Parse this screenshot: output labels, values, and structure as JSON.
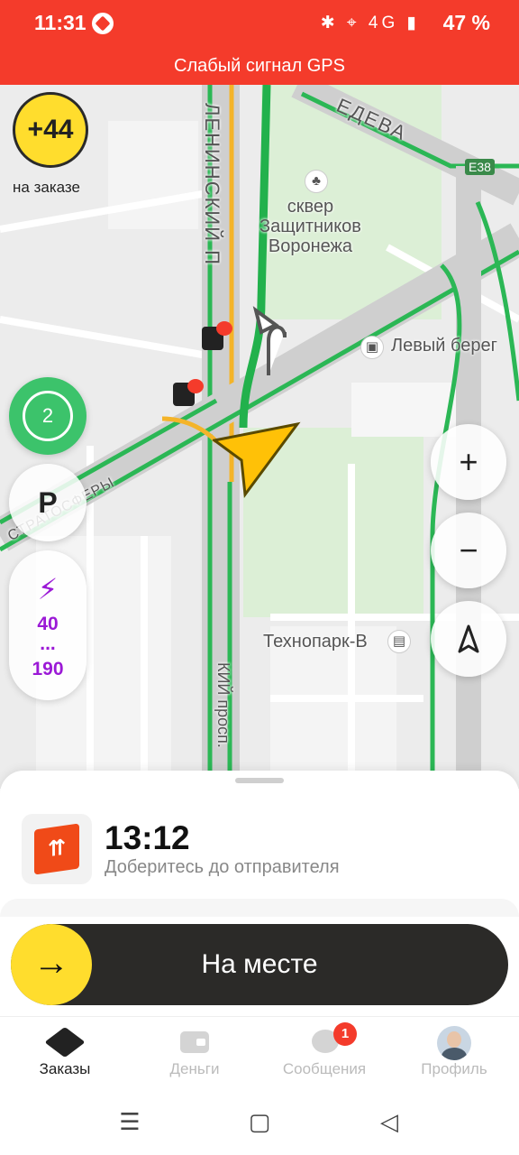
{
  "status_bar": {
    "time": "11:31",
    "icons": "✱ ⌖ 4G ▮",
    "battery": "47 %"
  },
  "gps_banner": "Слабый сигнал GPS",
  "map": {
    "street_leninsky": "ЛЕНИНСКИЙ П",
    "street_leninsky_bottom": "КИЙ просп.",
    "street_top": "ЕДЕВА",
    "street_sfery": "СТРАТОСФЕРЫ",
    "road_code": "E38",
    "park_name": "сквер\nЗащитников\nВоронежа",
    "poi_left_bank": "Левый берег",
    "poi_technopark": "Технопарк-В"
  },
  "widgets": {
    "earnings": "+44",
    "earnings_label": "на заказе",
    "gps_count": "2",
    "parking": "P",
    "speed_min": "40",
    "speed_dots": "...",
    "speed_max": "190"
  },
  "map_controls": {
    "zoom_in": "+",
    "zoom_out": "−"
  },
  "order": {
    "eta": "13:12",
    "instruction": "Доберитесь до отправителя",
    "slider_label": "На месте"
  },
  "tabs": [
    {
      "label": "Заказы",
      "active": true
    },
    {
      "label": "Деньги",
      "active": false
    },
    {
      "label": "Сообщения",
      "active": false,
      "badge": "1"
    },
    {
      "label": "Профиль",
      "active": false
    }
  ],
  "colors": {
    "accent_red": "#f43b2b",
    "accent_yellow": "#ffdd2d",
    "route_green": "#2bb755",
    "speed_purple": "#9b19d6"
  }
}
